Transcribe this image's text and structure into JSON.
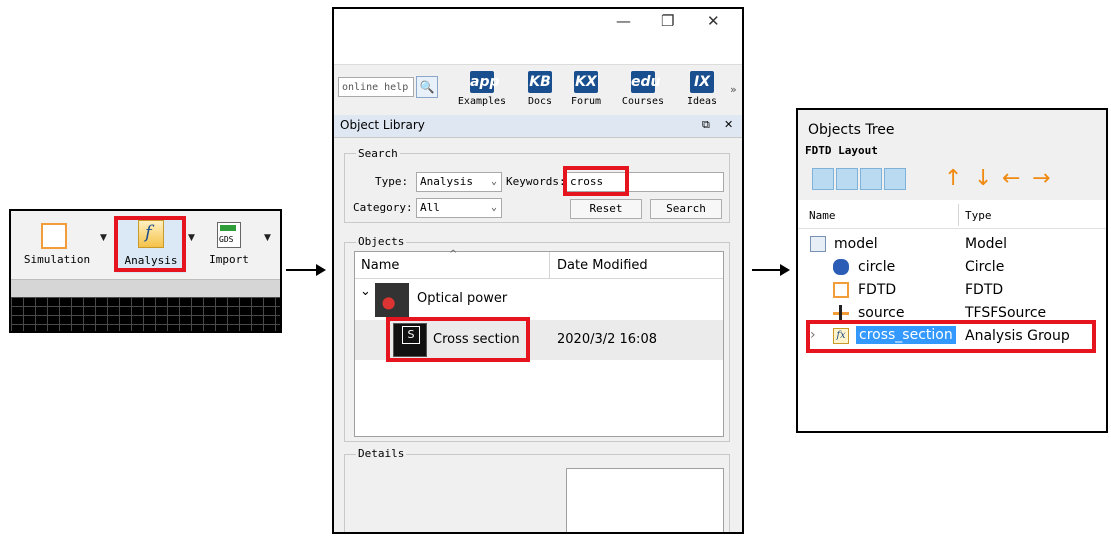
{
  "ribbon": {
    "buttons": [
      {
        "label": "Simulation",
        "icon": "simulation-square-icon"
      },
      {
        "label": "Analysis",
        "icon": "analysis-function-icon"
      },
      {
        "label": "Import",
        "icon": "gds-import-icon",
        "badge": "GDS"
      }
    ]
  },
  "library": {
    "window_controls": {
      "minimize": "—",
      "restore": "❐",
      "close": "✕"
    },
    "toolbar": {
      "search_placeholder": "online help",
      "items": [
        {
          "icon_text": "app",
          "label": "Examples"
        },
        {
          "icon_text": "KB",
          "label": "Docs"
        },
        {
          "icon_text": "KX",
          "label": "Forum"
        },
        {
          "icon_text": "edu",
          "label": "Courses"
        },
        {
          "icon_text": "IX",
          "label": "Ideas"
        }
      ],
      "overflow": "»"
    },
    "title": "Object Library",
    "title_controls": {
      "float": "⧉",
      "close": "✕"
    },
    "search": {
      "group_label": "Search",
      "type_label": "Type:",
      "type_value": "Analysis",
      "keywords_label": "Keywords:",
      "keywords_value": "cross",
      "category_label": "Category:",
      "category_value": "All",
      "reset_label": "Reset",
      "search_label": "Search"
    },
    "objects": {
      "group_label": "Objects",
      "columns": [
        "Name",
        "Date Modified"
      ],
      "sort_indicator": "^",
      "folder": {
        "expander": "⌄",
        "label": "Optical power"
      },
      "item": {
        "label": "Cross section",
        "date": "2020/3/2 16:08"
      }
    },
    "details": {
      "group_label": "Details"
    }
  },
  "objects_tree": {
    "title": "Objects Tree",
    "subtitle": "FDTD Layout",
    "columns": [
      "Name",
      "Type"
    ],
    "rows": [
      {
        "name": "model",
        "type": "Model",
        "icon": "model-icon"
      },
      {
        "name": "circle",
        "type": "Circle",
        "icon": "cylinder-icon"
      },
      {
        "name": "FDTD",
        "type": "FDTD",
        "icon": "fdtd-region-icon"
      },
      {
        "name": "source",
        "type": "TFSFSource",
        "icon": "source-icon"
      },
      {
        "name": "cross_section",
        "type": "Analysis Group",
        "icon": "analysis-fx-icon",
        "expander": "›",
        "fx": "fx"
      }
    ],
    "arrows": [
      "↑",
      "↓",
      "←",
      "→"
    ]
  },
  "colors": {
    "highlight_red": "#e5141e",
    "selection_blue": "#3399ff",
    "arrow_orange": "#f08a12"
  }
}
